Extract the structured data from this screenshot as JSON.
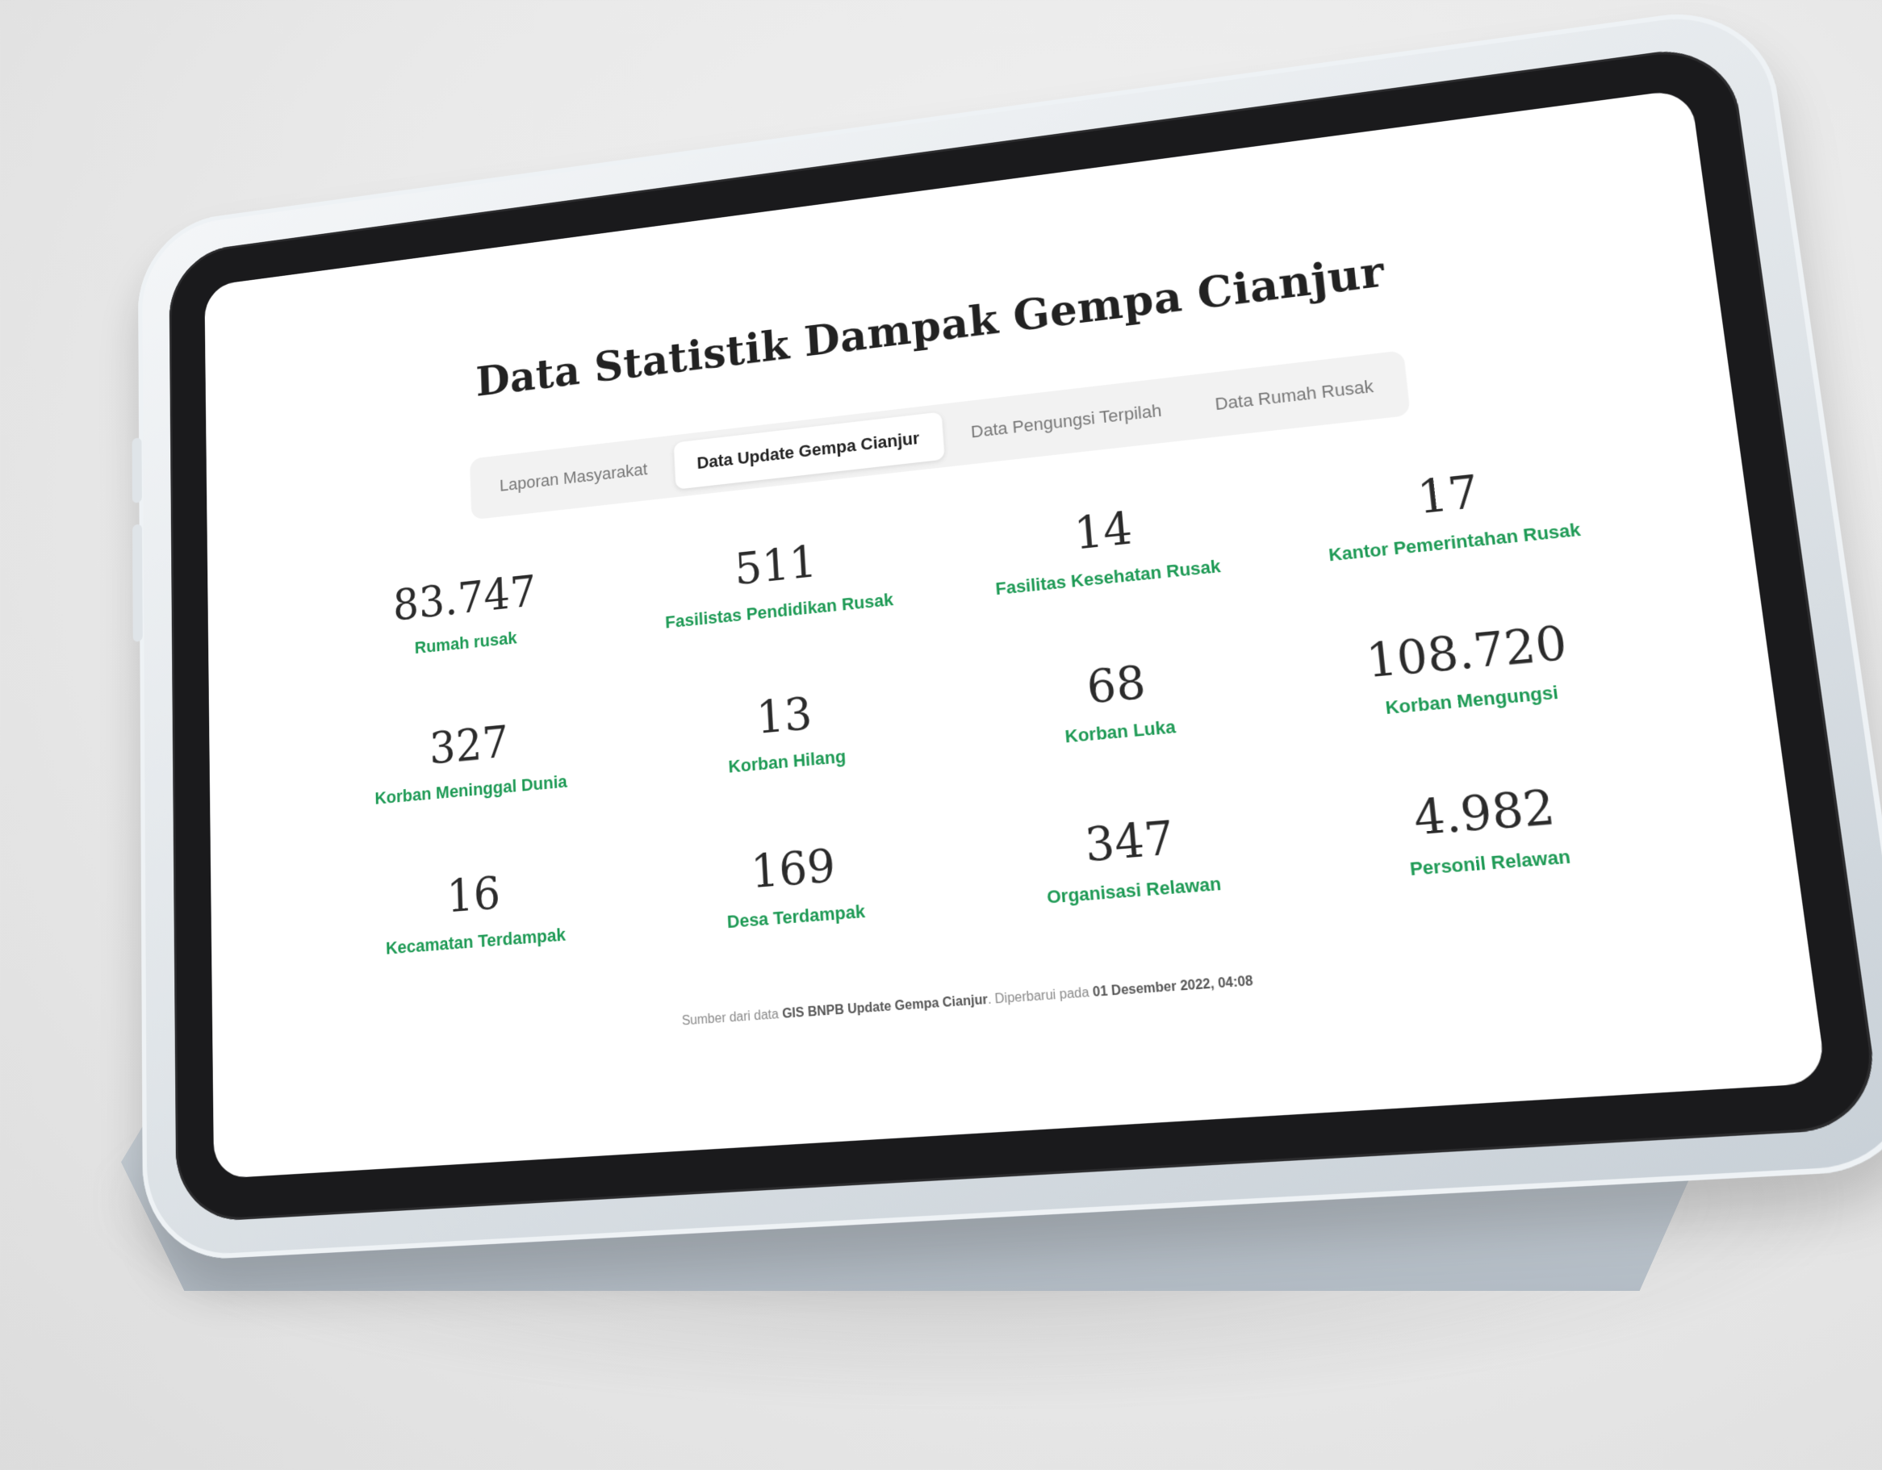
{
  "page": {
    "title": "Data Statistik Dampak Gempa Cianjur"
  },
  "tabs": [
    {
      "label": "Laporan Masyarakat",
      "active": false
    },
    {
      "label": "Data Update Gempa Cianjur",
      "active": true
    },
    {
      "label": "Data Pengungsi Terpilah",
      "active": false
    },
    {
      "label": "Data Rumah Rusak",
      "active": false
    }
  ],
  "stats": [
    {
      "value": "83.747",
      "label": "Rumah rusak"
    },
    {
      "value": "511",
      "label": "Fasilistas Pendidikan Rusak"
    },
    {
      "value": "14",
      "label": "Fasilitas Kesehatan Rusak"
    },
    {
      "value": "17",
      "label": "Kantor Pemerintahan Rusak"
    },
    {
      "value": "327",
      "label": "Korban Meninggal Dunia"
    },
    {
      "value": "13",
      "label": "Korban Hilang"
    },
    {
      "value": "68",
      "label": "Korban Luka"
    },
    {
      "value": "108.720",
      "label": "Korban Mengungsi"
    },
    {
      "value": "16",
      "label": "Kecamatan Terdampak"
    },
    {
      "value": "169",
      "label": "Desa Terdampak"
    },
    {
      "value": "347",
      "label": "Organisasi Relawan"
    },
    {
      "value": "4.982",
      "label": "Personil Relawan"
    }
  ],
  "source": {
    "prefix": "Sumber dari data ",
    "source_name": "GIS BNPB Update Gempa Cianjur",
    "middle": ". Diperbarui pada ",
    "updated": "01 Desember 2022, 04:08"
  },
  "colors": {
    "accent": "#1e9a55",
    "value_text": "#2b2b2b"
  }
}
